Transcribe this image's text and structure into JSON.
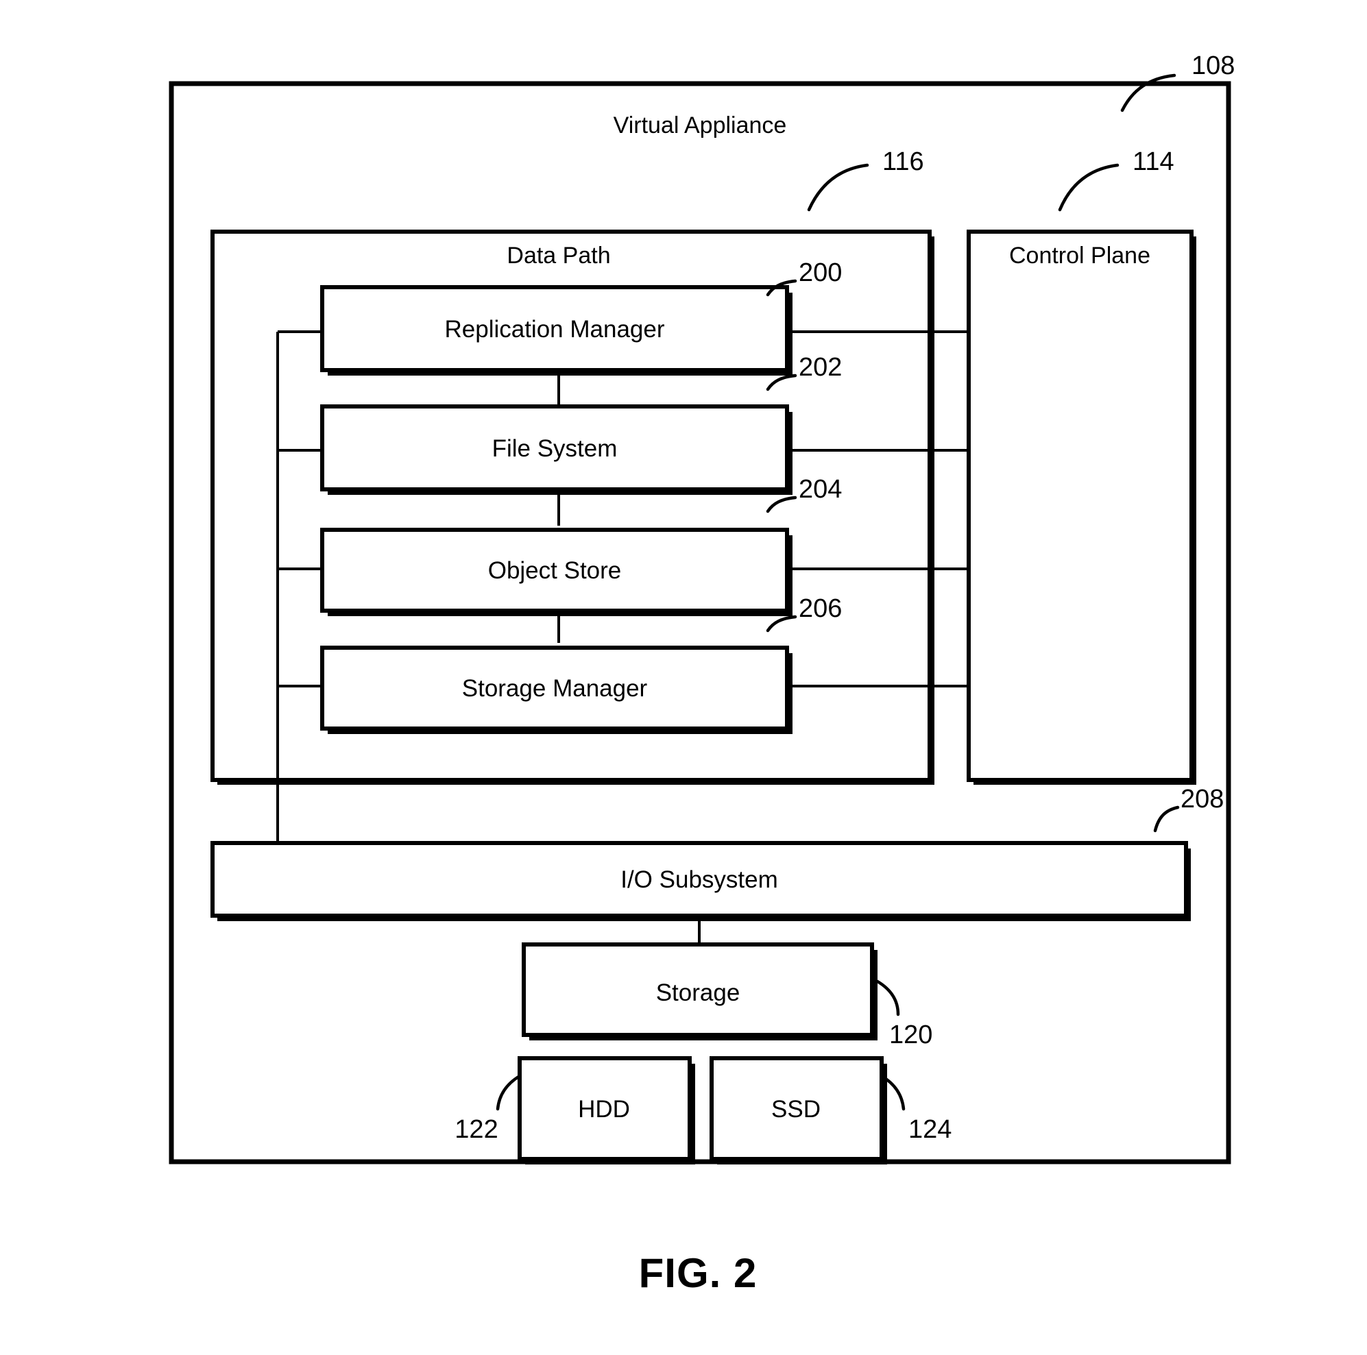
{
  "figure": {
    "caption": "FIG. 2",
    "outer": {
      "title": "Virtual Appliance",
      "ref": "108"
    },
    "containers": [
      {
        "name": "data-path",
        "title": "Data Path",
        "ref": "116"
      },
      {
        "name": "control-plane",
        "title": "Control Plane",
        "ref": "114"
      }
    ],
    "data_path_blocks": [
      {
        "name": "replication-manager",
        "title": "Replication Manager",
        "ref": "200"
      },
      {
        "name": "file-system",
        "title": "File System",
        "ref": "202"
      },
      {
        "name": "object-store",
        "title": "Object Store",
        "ref": "204"
      },
      {
        "name": "storage-manager",
        "title": "Storage Manager",
        "ref": "206"
      }
    ],
    "io_subsystem": {
      "title": "I/O Subsystem",
      "ref": "208"
    },
    "storage": {
      "title": "Storage",
      "ref": "120"
    },
    "media": [
      {
        "name": "hdd",
        "title": "HDD",
        "ref": "122"
      },
      {
        "name": "ssd",
        "title": "SSD",
        "ref": "124"
      }
    ],
    "colors": {
      "line": "#000000",
      "background": "#ffffff"
    }
  }
}
